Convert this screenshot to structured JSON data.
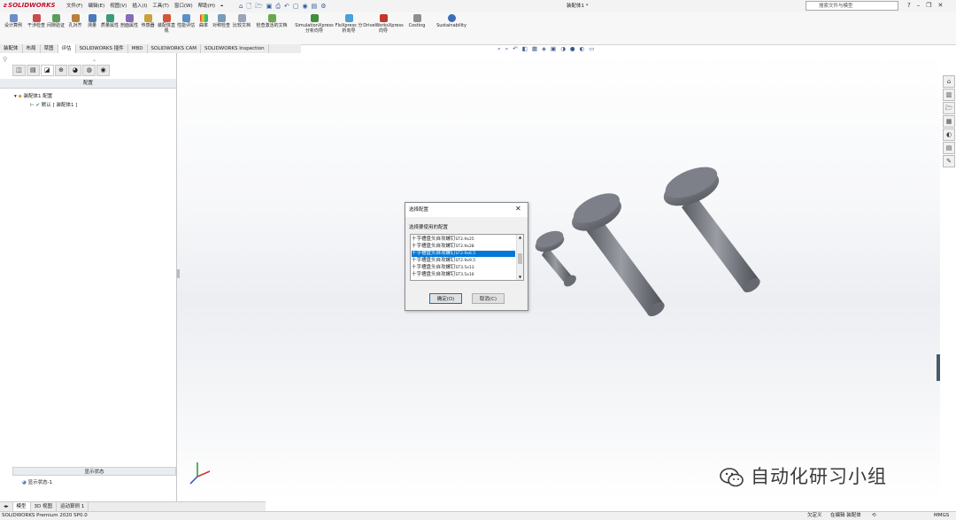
{
  "app": {
    "logo": "SOLIDWORKS",
    "title": "装配体1 *"
  },
  "menu": [
    "文件(F)",
    "编辑(E)",
    "视图(V)",
    "插入(I)",
    "工具(T)",
    "窗口(W)",
    "帮助(H)"
  ],
  "search": {
    "placeholder": "搜索文件与模型"
  },
  "ribbon": [
    {
      "label": "设计算例"
    },
    {
      "label": "干涉检查"
    },
    {
      "label": "间隙验证"
    },
    {
      "label": "孔对齐"
    },
    {
      "label": "测量"
    },
    {
      "label": "质量属性"
    },
    {
      "label": "剖面属性"
    },
    {
      "label": "传感器"
    },
    {
      "label": "装配体直观"
    },
    {
      "label": "性能评估"
    },
    {
      "label": "曲率"
    },
    {
      "label": "对称检查"
    },
    {
      "label": "比较文档"
    },
    {
      "label": "检查激活的文档"
    },
    {
      "label": "SimulationXpress 分析向导"
    },
    {
      "label": "FloXpress 分析向导"
    },
    {
      "label": "DriveWorksXpress 向导"
    },
    {
      "label": "Costing"
    },
    {
      "label": "Sustainability"
    }
  ],
  "cmd_tabs": [
    "装配体",
    "布局",
    "草图",
    "评估",
    "SOLIDWORKS 插件",
    "MBD",
    "SOLIDWORKS CAM",
    "SOLIDWORKS Inspection"
  ],
  "cmd_tab_active": "评估",
  "left_panel": {
    "header": "配置",
    "tree_root": "装配体1 配置",
    "tree_child": "默认 [ 装配体1 ]",
    "display_state_header": "显示状态",
    "display_state_item": "显示状态-1"
  },
  "dialog": {
    "title": "选择配置",
    "label": "选择要使用的配置",
    "items": [
      {
        "name": "十字槽盘头自攻螺钉",
        "size": "ST2.9x25"
      },
      {
        "name": "十字槽盘头自攻螺钉",
        "size": "ST2.9x28"
      },
      {
        "name": "十字槽盘头自攻螺钉",
        "size": "ST2.9x6.5"
      },
      {
        "name": "十字槽盘头自攻螺钉",
        "size": "ST2.9x9.5"
      },
      {
        "name": "十字槽盘头自攻螺钉",
        "size": "ST3.5x13"
      },
      {
        "name": "十字槽盘头自攻螺钉",
        "size": "ST3.5x16"
      }
    ],
    "selected_index": 2,
    "ok_label": "确定(O)",
    "cancel_label": "取消(C)"
  },
  "bottom_tabs": [
    "模型",
    "3D 视图",
    "运动算例 1"
  ],
  "bottom_tab_active": "模型",
  "status": {
    "version": "SOLIDWORKS Premium 2020 SP0.0",
    "custom": "欠定义",
    "editing": "在编辑 装配体",
    "units": "MMGS"
  },
  "watermark": "自动化研习小组",
  "colors": {
    "accent": "#0078d7",
    "brand": "#c8102e",
    "part": "#7d7f88"
  }
}
